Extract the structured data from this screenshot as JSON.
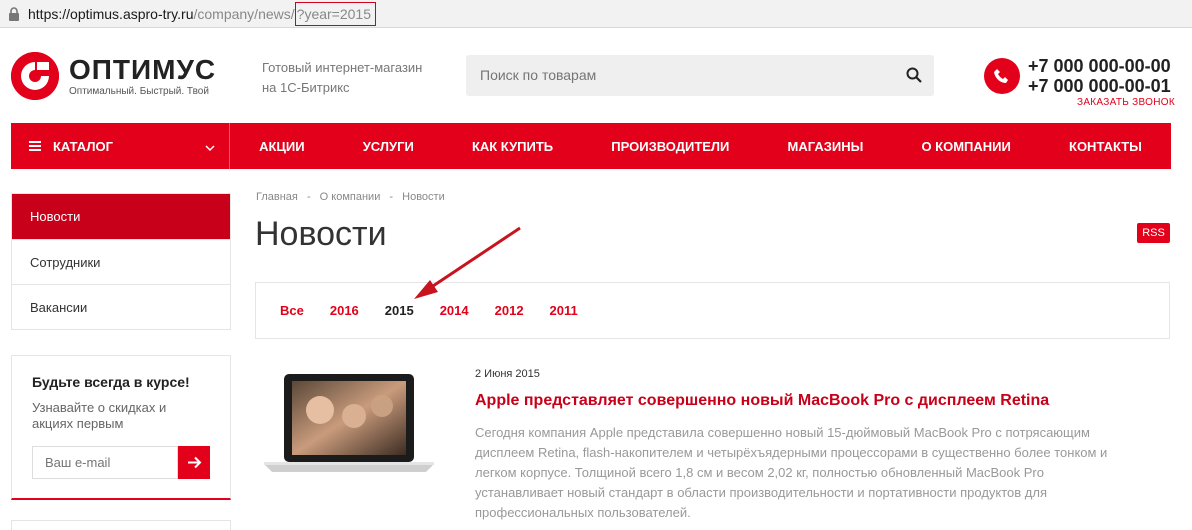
{
  "browser": {
    "url_scheme": "https://",
    "url_host": "optimus.aspro-try.ru",
    "url_path": "/company/news/",
    "url_query": "?year=2015"
  },
  "header": {
    "logo_name": "ОПТИМУС",
    "logo_slogan": "Оптимальный. Быстрый. Твой",
    "tagline_line1": "Готовый интернет-магазин",
    "tagline_line2": "на 1С-Битрикс",
    "search_placeholder": "Поиск по товарам",
    "phone1": "+7 000 000-00-00",
    "phone2": "+7 000 000-00-01",
    "callback_label": "ЗАКАЗАТЬ ЗВОНОК"
  },
  "nav": {
    "catalog_label": "КАТАЛОГ",
    "items": [
      "АКЦИИ",
      "УСЛУГИ",
      "КАК КУПИТЬ",
      "ПРОИЗВОДИТЕЛИ",
      "МАГАЗИНЫ",
      "О КОМПАНИИ",
      "КОНТАКТЫ"
    ]
  },
  "sidebar": {
    "items": [
      "Новости",
      "Сотрудники",
      "Вакансии"
    ],
    "active_index": 0,
    "subscribe_title": "Будьте всегда в курсе!",
    "subscribe_text_line1": "Узнавайте о скидках и",
    "subscribe_text_line2": "акциях первым",
    "email_placeholder": "Ваш e-mail"
  },
  "main": {
    "breadcrumbs": [
      "Главная",
      "-",
      "О компании",
      "-",
      "Новости"
    ],
    "title": "Новости",
    "rss_label": "RSS",
    "years": [
      "Все",
      "2016",
      "2015",
      "2014",
      "2012",
      "2011"
    ],
    "current_year": "2015"
  },
  "article": {
    "date": "2 Июня 2015",
    "title": "Apple представляет совершенно новый MacBook Pro с дисплеем Retina",
    "text_lines": [
      "Сегодня компания Apple представила совершенно новый 15-дюймовый MacBook Pro с потрясающим",
      "дисплеем Retina, flash-накопителем и четырёхъядерными процессорами в существенно более тонком и",
      "легком корпусе. Толщиной всего 1,8 см и весом 2,02 кг, полностью обновленный MacBook Pro",
      "устанавливает новый стандарт в области производительности и портативности продуктов для",
      "профессиональных пользователей."
    ]
  },
  "colors": {
    "accent": "#e2001a",
    "accent_dark": "#c8001a"
  }
}
